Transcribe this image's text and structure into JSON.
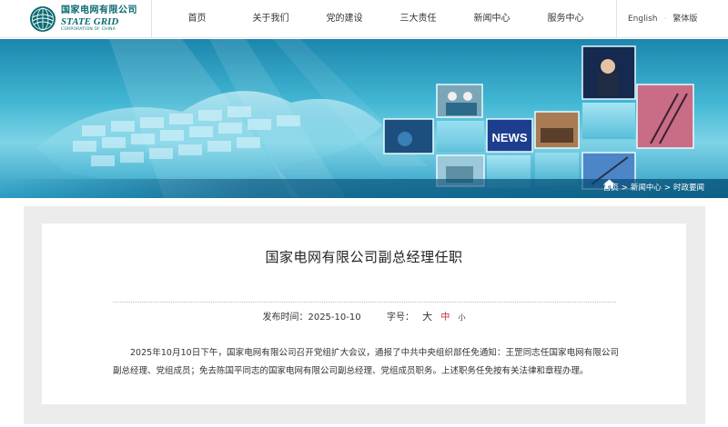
{
  "header": {
    "logo_cn": "国家电网有限公司",
    "logo_en": "STATE GRID",
    "logo_sub": "CORPORATION OF CHINA",
    "nav": [
      "首页",
      "关于我们",
      "党的建设",
      "三大责任",
      "新闻中心",
      "服务中心"
    ],
    "lang_en": "English",
    "lang_sep": "·",
    "lang_tc": "繁体版"
  },
  "banner": {
    "news_sign": "NEWS",
    "breadcrumb": [
      "首页",
      "新闻中心",
      "时政要闻"
    ],
    "breadcrumb_sep": ">"
  },
  "article": {
    "title": "国家电网有限公司副总经理任职",
    "publish_label": "发布时间：",
    "publish_date": "2025-10-10",
    "font_label": "字号：",
    "font_large": "大",
    "font_mid": "中",
    "font_small": "小",
    "body": "2025年10月10日下午，国家电网有限公司召开党组扩大会议，通报了中共中央组织部任免通知：王罡同志任国家电网有限公司副总经理、党组成员；免去陈国平同志的国家电网有限公司副总经理、党组成员职务。上述职务任免按有关法律和章程办理。"
  },
  "colors": {
    "brand": "#0b6a73",
    "accent_red": "#c0272d",
    "content_bg": "#ececec"
  }
}
